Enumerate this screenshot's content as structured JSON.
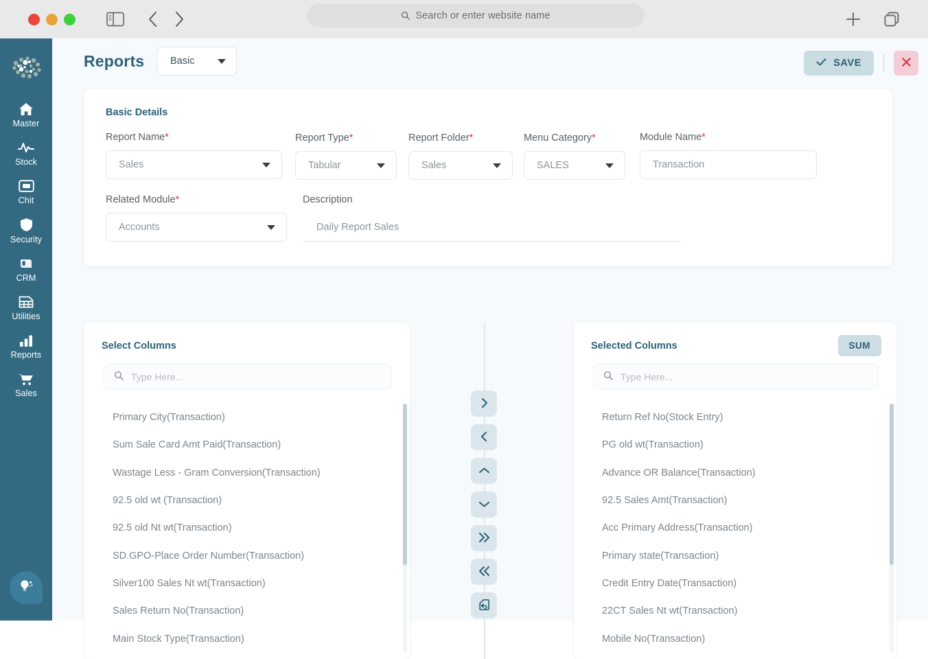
{
  "browser": {
    "search_placeholder": "Search or enter website name",
    "icons": [
      "close-window",
      "minimize-window",
      "maximize-window",
      "sidebar-toggle-icon",
      "back-icon",
      "forward-icon",
      "search-icon",
      "new-tab-icon",
      "tab-overview-icon"
    ]
  },
  "sidebar": {
    "logo_name": "app-logo",
    "items": [
      {
        "label": "Master",
        "icon": "home-icon"
      },
      {
        "label": "Stock",
        "icon": "pulse-icon"
      },
      {
        "label": "Chit",
        "icon": "card-icon"
      },
      {
        "label": "Security",
        "icon": "shield-icon"
      },
      {
        "label": "CRM",
        "icon": "contact-icon"
      },
      {
        "label": "Utilities",
        "icon": "grid-icon"
      },
      {
        "label": "Reports",
        "icon": "bar-chart-icon"
      },
      {
        "label": "Sales",
        "icon": "cart-icon"
      }
    ],
    "help_icon": "lightbulb-icon"
  },
  "header": {
    "title": "Reports",
    "mode_select": "Basic",
    "save_label": "SAVE",
    "save_icon": "check-icon",
    "close_icon": "close-icon"
  },
  "basic_details": {
    "title": "Basic Details",
    "fields": [
      {
        "label": "Report Name",
        "required": true,
        "value": "Sales",
        "type": "select"
      },
      {
        "label": "Report Type",
        "required": true,
        "value": "Tabular",
        "type": "select"
      },
      {
        "label": "Report Folder",
        "required": true,
        "value": "Sales",
        "type": "select"
      },
      {
        "label": "Menu Category",
        "required": true,
        "value": "SALES",
        "type": "select"
      },
      {
        "label": "Module Name",
        "required": true,
        "value": "Transaction",
        "type": "text"
      },
      {
        "label": "Related Module",
        "required": true,
        "value": "Accounts",
        "type": "select"
      },
      {
        "label": "Description",
        "required": false,
        "value": "Daily Report Sales",
        "type": "underline"
      }
    ]
  },
  "select_columns": {
    "title": "Select Columns",
    "search_placeholder": "Type Here...",
    "items": [
      "Primary City(Transaction)",
      "Sum Sale Card Amt Paid(Transaction)",
      "Wastage Less - Gram Conversion(Transaction)",
      "92.5 old wt (Transaction)",
      "92.5 old Nt wt(Transaction)",
      "SD.GPO-Place Order Number(Transaction)",
      "Silver100 Sales Nt wt(Transaction)",
      "Sales Return No(Transaction)",
      "Main Stock Type(Transaction)"
    ]
  },
  "selected_columns": {
    "title": "Selected Columns",
    "sum_label": "SUM",
    "search_placeholder": "Type Here...",
    "items": [
      "Return Ref No(Stock Entry)",
      "PG old wt(Transaction)",
      "Advance OR Balance(Transaction)",
      "92.5 Sales Amt(Transaction)",
      "Acc Primary Address(Transaction)",
      "Primary state(Transaction)",
      "Credit Entry Date(Transaction)",
      "22CT Sales Nt wt(Transaction)",
      "Mobile No(Transaction)"
    ]
  },
  "transfer_buttons": [
    {
      "name": "move-right-button",
      "icon": "chevron-right-icon"
    },
    {
      "name": "move-left-button",
      "icon": "chevron-left-icon"
    },
    {
      "name": "move-up-button",
      "icon": "chevron-up-icon"
    },
    {
      "name": "move-down-button",
      "icon": "chevron-down-icon"
    },
    {
      "name": "move-all-right-button",
      "icon": "double-chevron-right-icon"
    },
    {
      "name": "move-all-left-button",
      "icon": "double-chevron-left-icon"
    },
    {
      "name": "reset-button",
      "icon": "undo-tag-icon"
    }
  ],
  "colors": {
    "sidebar": "#336a82",
    "accent": "#2d6179",
    "save_bg": "#c9dce2",
    "close_bg": "#f3ced6",
    "close_fg": "#d8344a",
    "required": "#d8344a",
    "page_bg": "#f7fafc"
  }
}
